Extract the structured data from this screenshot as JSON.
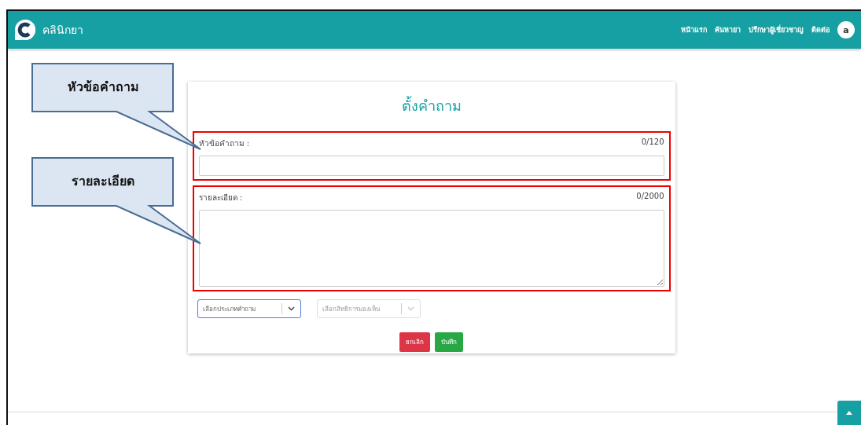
{
  "header": {
    "brand": "คลินิกยา",
    "nav": [
      "หน้าแรก",
      "ค้นหายา",
      "ปรึกษาผู้เชี่ยวชาญ",
      "ติดต่อ"
    ],
    "avatar": "a"
  },
  "form": {
    "title": "ตั้งคำถาม",
    "fields": [
      {
        "kind": "input",
        "label": "หัวข้อคำถาม :",
        "counter": "0/120",
        "highlighted": true
      },
      {
        "kind": "textarea",
        "label": "รายละเอียด :",
        "counter": "0/2000",
        "highlighted": true
      }
    ],
    "selects": [
      {
        "placeholder": "เลือกประเภทคำถาม",
        "focused": true,
        "disabled": false
      },
      {
        "placeholder": "เลือกสิทธิการมองเห็น",
        "focused": false,
        "disabled": true
      }
    ],
    "buttons": [
      {
        "label": "ยกเลิก",
        "kind": "cancel"
      },
      {
        "label": "บันทึก",
        "kind": "save"
      }
    ]
  },
  "callouts": [
    "หัวข้อคำถาม",
    "รายละเอียด"
  ]
}
